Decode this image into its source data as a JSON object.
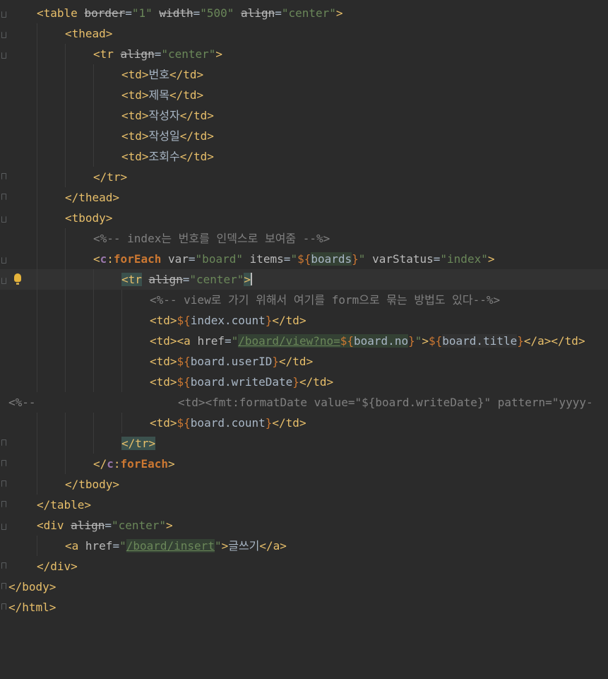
{
  "editor": {
    "lines": {
      "l01": {
        "o": "<table ",
        "a1": "border",
        "e1": "=",
        "v1": "\"1\"",
        "a2": "width",
        "e2": "=",
        "v2": "\"500\"",
        "a3": "align",
        "e3": "=",
        "v3": "\"center\"",
        "c": ">"
      },
      "l02": {
        "t": "<thead>"
      },
      "l03": {
        "o": "<tr ",
        "a1": "align",
        "e1": "=",
        "v1": "\"center\"",
        "c": ">"
      },
      "l04": {
        "o": "<td>",
        "txt": "번호",
        "c": "</td>"
      },
      "l05": {
        "o": "<td>",
        "txt": "제목",
        "c": "</td>"
      },
      "l06": {
        "o": "<td>",
        "txt": "작성자",
        "c": "</td>"
      },
      "l07": {
        "o": "<td>",
        "txt": "작성일",
        "c": "</td>"
      },
      "l08": {
        "o": "<td>",
        "txt": "조회수",
        "c": "</td>"
      },
      "l09": {
        "t": "</tr>"
      },
      "l10": {
        "t": "</thead>"
      },
      "l11": {
        "t": "<tbody>"
      },
      "l12": {
        "cm": "<%-- index는 번호를 인덱스로 보여줌 --%>"
      },
      "l13": {
        "o1": "<",
        "ns": "c",
        "col": ":",
        "el": "forEach",
        "sp1": " ",
        "a1": "var",
        "e1": "=",
        "v1": "\"board\"",
        "sp2": " ",
        "a2": "items",
        "e2": "=",
        "v2a": "\"",
        "ex1": "${",
        "ex2": "boards",
        "ex3": "}",
        "v2b": "\"",
        "sp3": " ",
        "a3": "varStatus",
        "e3": "=",
        "v3": "\"index\"",
        "c": ">"
      },
      "l14": {
        "o": "<tr",
        "sp": " ",
        "a1": "align",
        "e1": "=",
        "v1": "\"center\"",
        "c": ">"
      },
      "l15": {
        "cm": "<%-- view로 가기 위해서 여기를 form으로 묶는 방법도 있다--%>"
      },
      "l16": {
        "o": "<td>",
        "ex1": "${",
        "ex2": "index.count",
        "ex3": "}",
        "c": "</td>"
      },
      "l17": {
        "o1": "<td>",
        "o2": "<a ",
        "a1": "href",
        "e1": "=",
        "v1a": "\"",
        "url": "/board/view?no=",
        "ex1": "${",
        "ex2": "board.no",
        "ex3": "}",
        "v1b": "\"",
        "c1": ">",
        "ex4": "${",
        "ex5": "board.title",
        "ex6": "}",
        "c2": "</a></td>"
      },
      "l18": {
        "o": "<td>",
        "ex1": "${",
        "ex2": "board.userID",
        "ex3": "}",
        "c": "</td>"
      },
      "l19": {
        "o": "<td>",
        "ex1": "${",
        "ex2": "board.writeDate",
        "ex3": "}",
        "c": "</td>"
      },
      "l20": {
        "left": "<%--",
        "cm": "<td><fmt:formatDate value=\"${board.writeDate}\" pattern=\"yyyy-"
      },
      "l21": {
        "o": "<td>",
        "ex1": "${",
        "ex2": "board.count",
        "ex3": "}",
        "c": "</td>"
      },
      "l22": {
        "t": "</tr>"
      },
      "l23": {
        "o1": "</",
        "ns": "c",
        "col": ":",
        "el": "forEach",
        "c": ">"
      },
      "l24": {
        "t": "</tbody>"
      },
      "l25": {
        "t": "</table>"
      },
      "l26": {
        "o": "<div ",
        "a1": "align",
        "e1": "=",
        "v1": "\"center\"",
        "c": ">"
      },
      "l27": {
        "o": "<a ",
        "a1": "href",
        "e1": "=",
        "v1a": "\"",
        "url": "/board/insert",
        "v1b": "\"",
        "c1": ">",
        "txt": "글쓰기",
        "c2": "</a>"
      },
      "l28": {
        "t": "</div>"
      },
      "l29": {
        "t": "</body>"
      },
      "l30": {
        "t": "</html>"
      }
    }
  },
  "colors": {
    "background": "#2b2b2b",
    "tag": "#e8bf6a",
    "attribute": "#bababa",
    "string": "#6a8759",
    "comment": "#808080",
    "keyword": "#cc7832",
    "namespace": "#9876aa",
    "text": "#a9b7c6"
  },
  "icons": [
    "intention-bulb-icon",
    "fold-marker-icon"
  ]
}
